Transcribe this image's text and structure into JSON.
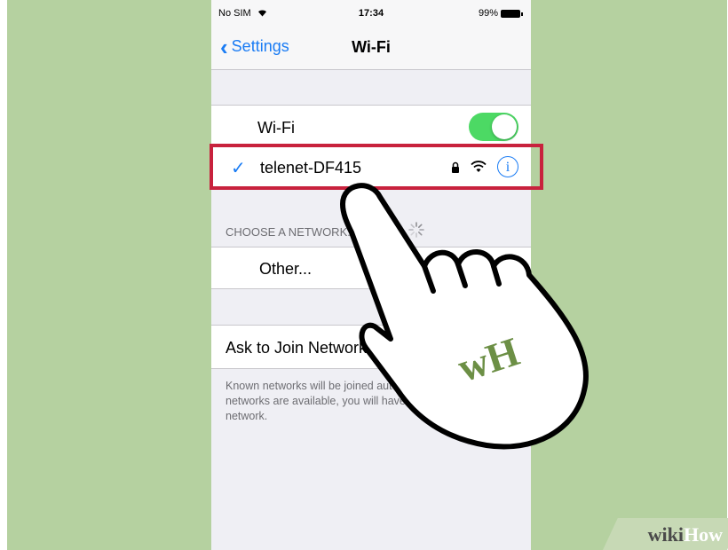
{
  "status_bar": {
    "carrier": "No SIM",
    "time": "17:34",
    "battery": "99%"
  },
  "nav": {
    "back_label": "Settings",
    "title": "Wi-Fi"
  },
  "wifi_toggle": {
    "label": "Wi-Fi",
    "on": true
  },
  "connected_network": {
    "name": "telenet-DF415",
    "secured": true
  },
  "choose_network_header": "CHOOSE A NETWORK...",
  "other_label": "Other...",
  "ask_to_join": {
    "label": "Ask to Join Networks",
    "on": true
  },
  "footer_text": "Known networks will be joined automatically. If no known networks are available, you will have to manually select a network.",
  "overlay": {
    "logo_letters": "wH",
    "watermark_wiki": "wiki",
    "watermark_how": "How"
  },
  "colors": {
    "accent": "#1a7cf4",
    "toggle_on": "#4cd964",
    "highlight": "#c8223d",
    "background": "#b5d1a0"
  }
}
